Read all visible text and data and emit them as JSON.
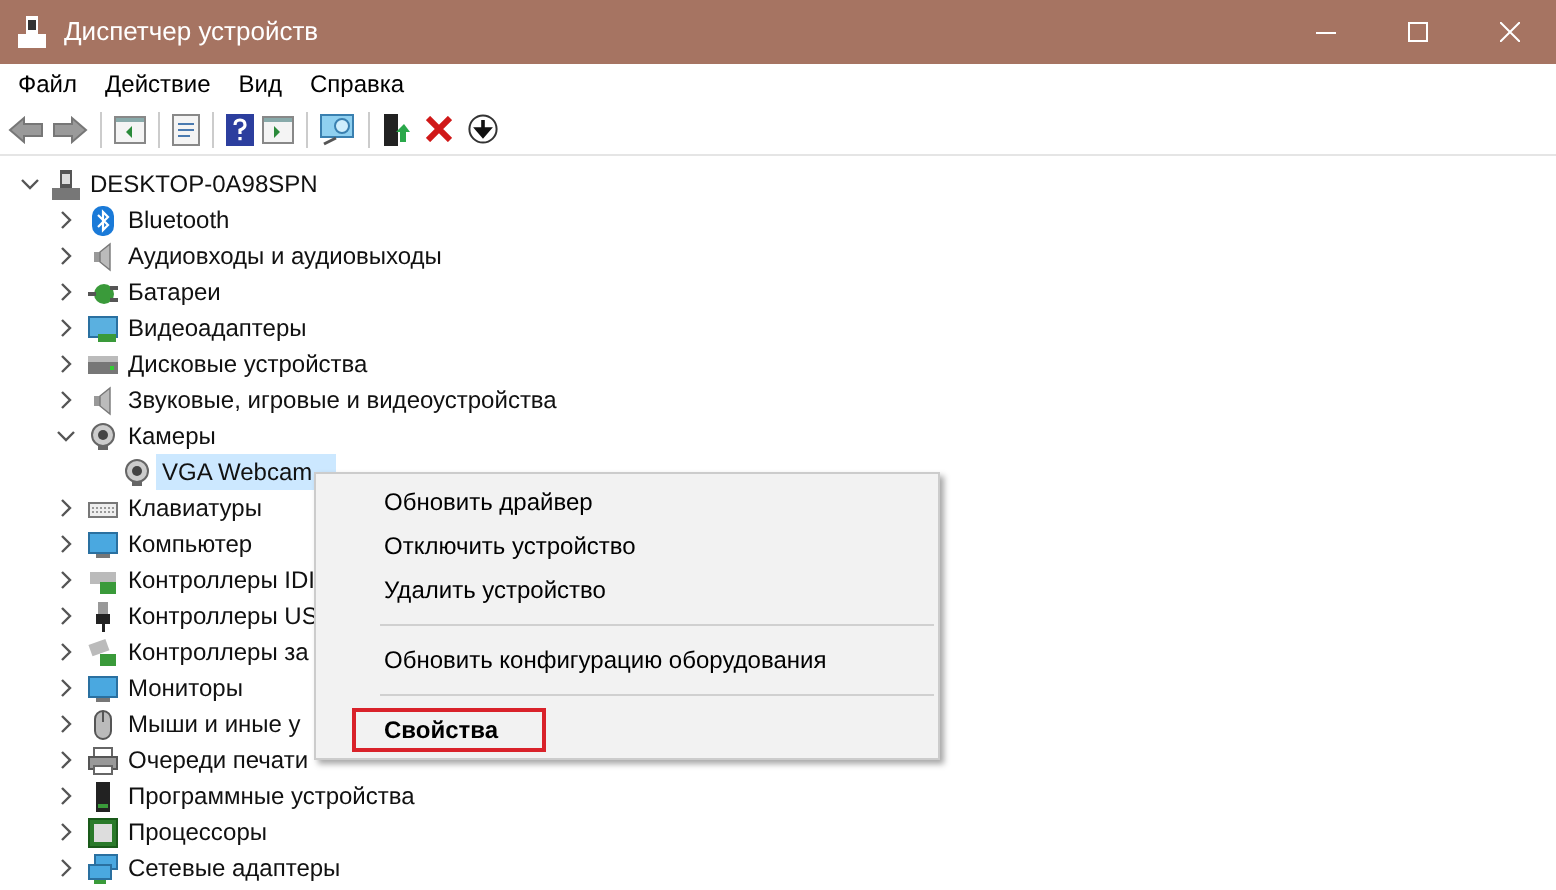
{
  "window": {
    "title": "Диспетчер устройств"
  },
  "menu_bar": [
    "Файл",
    "Действие",
    "Вид",
    "Справка"
  ],
  "tree": {
    "label": "DESKTOP-0A98SPN",
    "expanded": true,
    "selected": false,
    "children": [
      {
        "label": "Bluetooth",
        "expanded": false,
        "selected": false
      },
      {
        "label": "Аудиовходы и аудиовыходы",
        "expanded": false,
        "selected": false
      },
      {
        "label": "Батареи",
        "expanded": false,
        "selected": false
      },
      {
        "label": "Видеоадаптеры",
        "expanded": false,
        "selected": false
      },
      {
        "label": "Дисковые устройства",
        "expanded": false,
        "selected": false
      },
      {
        "label": "Звуковые, игровые и видеоустройства",
        "expanded": false,
        "selected": false
      },
      {
        "label": "Камеры",
        "expanded": true,
        "selected": false,
        "children": [
          {
            "label": "VGA Webcam",
            "selected": true
          }
        ]
      },
      {
        "label": "Клавиатуры",
        "expanded": false,
        "selected": false
      },
      {
        "label": "Компьютер",
        "expanded": false,
        "selected": false
      },
      {
        "label": "Контроллеры IDI",
        "expanded": false,
        "selected": false
      },
      {
        "label": "Контроллеры US",
        "expanded": false,
        "selected": false
      },
      {
        "label": "Контроллеры за",
        "expanded": false,
        "selected": false
      },
      {
        "label": "Мониторы",
        "expanded": false,
        "selected": false
      },
      {
        "label": "Мыши и иные у",
        "expanded": false,
        "selected": false
      },
      {
        "label": "Очереди печати",
        "expanded": false,
        "selected": false
      },
      {
        "label": "Программные устройства",
        "expanded": false,
        "selected": false
      },
      {
        "label": "Процессоры",
        "expanded": false,
        "selected": false
      },
      {
        "label": "Сетевые адаптеры",
        "expanded": false,
        "selected": false
      }
    ]
  },
  "context_menu": {
    "groups": [
      [
        {
          "label": "Обновить драйвер",
          "bold": false,
          "highlighted": false
        },
        {
          "label": "Отключить устройство",
          "bold": false,
          "highlighted": false
        },
        {
          "label": "Удалить устройство",
          "bold": false,
          "highlighted": false
        }
      ],
      [
        {
          "label": "Обновить конфигурацию оборудования",
          "bold": false,
          "highlighted": false
        }
      ],
      [
        {
          "label": "Свойства",
          "bold": true,
          "highlighted": true
        }
      ]
    ]
  }
}
